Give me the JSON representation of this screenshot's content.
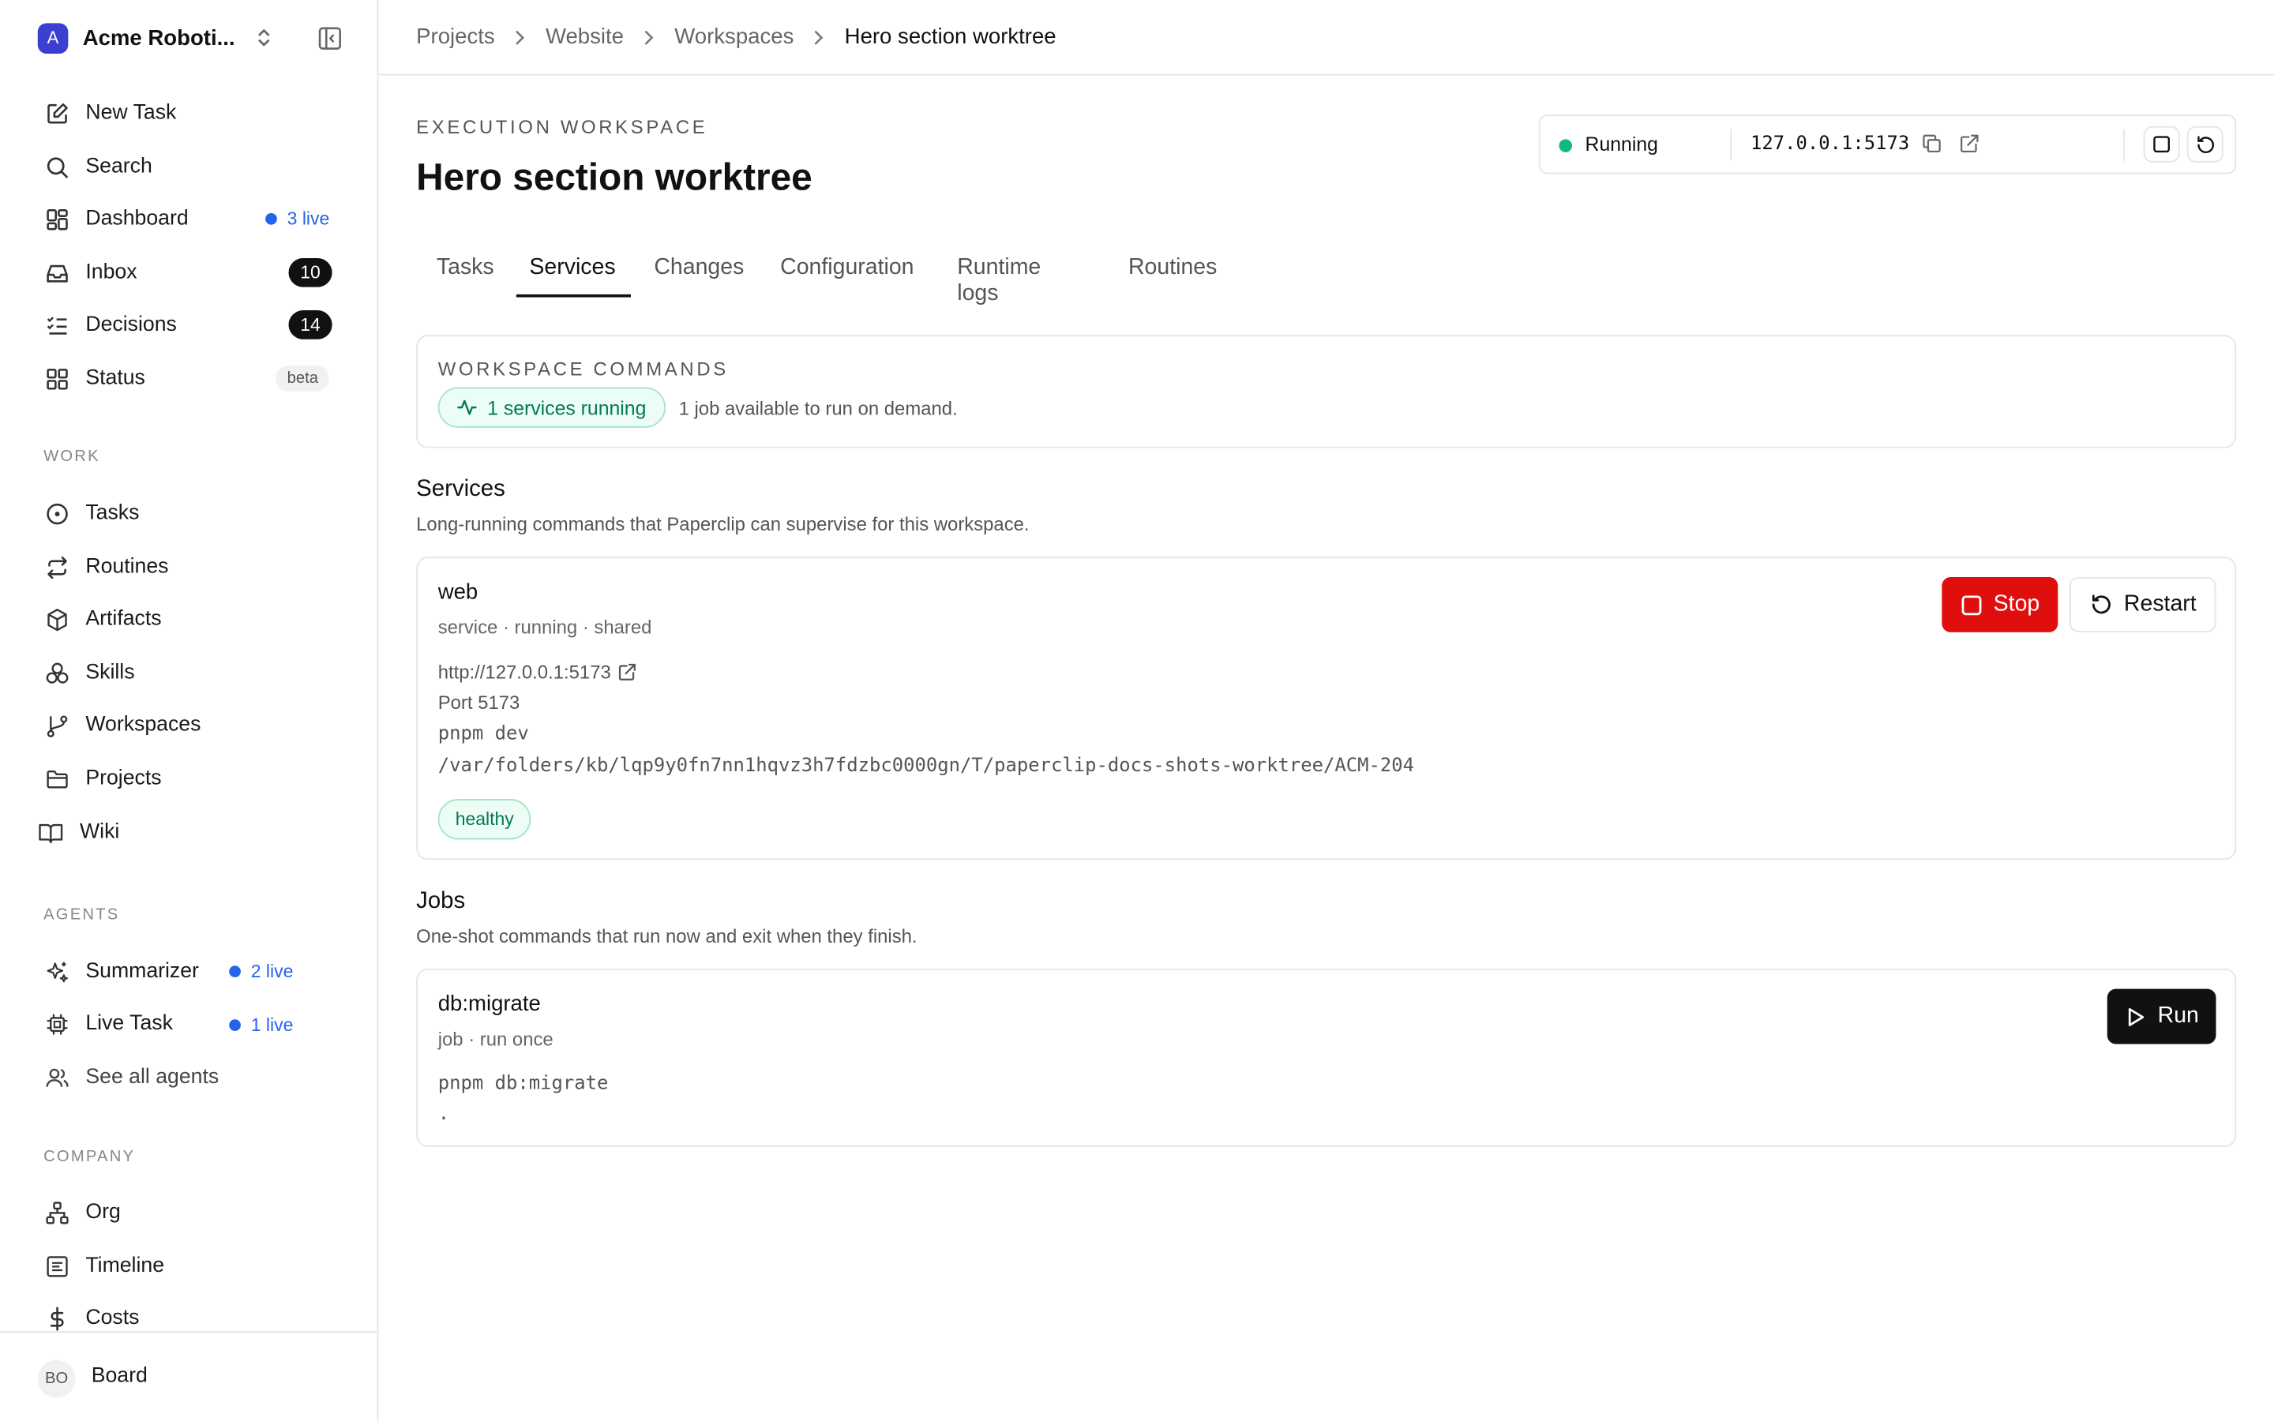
{
  "sidebar": {
    "company_initial": "A",
    "company_name": "Acme Roboti...",
    "top_items": [
      {
        "label": "New Task",
        "icon": "edit-icon"
      },
      {
        "label": "Search",
        "icon": "search-icon"
      },
      {
        "label": "Dashboard",
        "icon": "dashboard-icon",
        "live": "3 live"
      },
      {
        "label": "Inbox",
        "icon": "inbox-icon",
        "count": "10"
      },
      {
        "label": "Decisions",
        "icon": "checklist-icon",
        "count": "14"
      },
      {
        "label": "Status",
        "icon": "grid-icon",
        "badge": "beta"
      }
    ],
    "work_label": "WORK",
    "work_items": [
      {
        "label": "Tasks",
        "icon": "circle-dot-icon"
      },
      {
        "label": "Routines",
        "icon": "repeat-icon"
      },
      {
        "label": "Artifacts",
        "icon": "package-icon"
      },
      {
        "label": "Skills",
        "icon": "boxes-icon"
      },
      {
        "label": "Workspaces",
        "icon": "git-branch-icon"
      },
      {
        "label": "Projects",
        "icon": "folder-icon"
      },
      {
        "label": "Wiki",
        "icon": "book-icon"
      }
    ],
    "agents_label": "AGENTS",
    "agent_items": [
      {
        "label": "Summarizer",
        "icon": "sparkles-icon",
        "live": "2 live"
      },
      {
        "label": "Live Task",
        "icon": "cpu-icon",
        "live": "1 live"
      },
      {
        "label": "See all agents",
        "icon": "users-icon"
      }
    ],
    "company_label": "COMPANY",
    "company_items": [
      {
        "label": "Org",
        "icon": "org-chart-icon"
      },
      {
        "label": "Timeline",
        "icon": "timeline-icon"
      },
      {
        "label": "Costs",
        "icon": "dollar-icon"
      }
    ],
    "board_initials": "BO",
    "board_label": "Board"
  },
  "breadcrumb": [
    "Projects",
    "Website",
    "Workspaces",
    "Hero section worktree"
  ],
  "header": {
    "eyebrow": "EXECUTION WORKSPACE",
    "title": "Hero section worktree",
    "status": "Running",
    "address": "127.0.0.1:5173",
    "status_color": "#10b981"
  },
  "tabs": [
    "Tasks",
    "Services",
    "Changes",
    "Configuration",
    "Runtime logs",
    "Routines"
  ],
  "active_tab": "Services",
  "commands": {
    "eyebrow": "WORKSPACE COMMANDS",
    "running_pill": "1 services running",
    "jobs_text": "1 job available to run on demand."
  },
  "services": {
    "title": "Services",
    "subtitle": "Long-running commands that Paperclip can supervise for this workspace.",
    "items": [
      {
        "name": "web",
        "meta": "service · running · shared",
        "url": "http://127.0.0.1:5173",
        "port": "Port 5173",
        "command": "pnpm dev",
        "cwd": "/var/folders/kb/lqp9y0fn7nn1hqvz3h7fdzbc0000gn/T/paperclip-docs-shots-worktree/ACM-204",
        "health": "healthy",
        "stop_label": "Stop",
        "restart_label": "Restart"
      }
    ]
  },
  "jobs": {
    "title": "Jobs",
    "subtitle": "One-shot commands that run now and exit when they finish.",
    "items": [
      {
        "name": "db:migrate",
        "meta": "job · run once",
        "command": "pnpm db:migrate",
        "cwd": ".",
        "run_label": "Run"
      }
    ]
  },
  "colors": {
    "accent_live": "#2563eb",
    "stop": "#e10e0e",
    "healthy_bg": "#ecfdf5",
    "healthy_text": "#047857"
  }
}
